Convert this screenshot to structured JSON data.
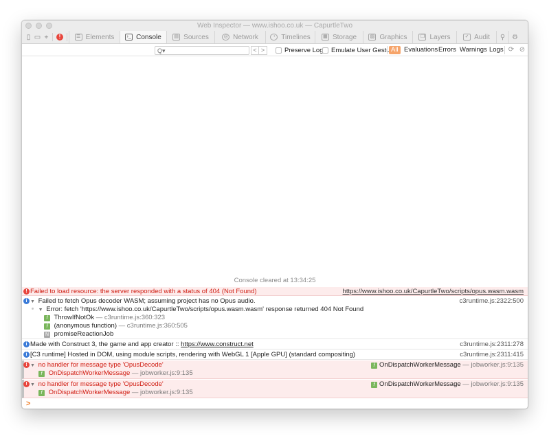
{
  "window": {
    "title": "Web Inspector — www.ishoo.co.uk — CapurtleTwo"
  },
  "tabs": [
    {
      "label": "Elements",
      "active": false
    },
    {
      "label": "Console",
      "active": true
    },
    {
      "label": "Sources",
      "active": false
    },
    {
      "label": "Network",
      "active": false
    },
    {
      "label": "Timelines",
      "active": false
    },
    {
      "label": "Storage",
      "active": false
    },
    {
      "label": "Graphics",
      "active": false
    },
    {
      "label": "Layers",
      "active": false
    },
    {
      "label": "Audit",
      "active": false
    }
  ],
  "toolbar": {
    "error_badge": "!"
  },
  "filter": {
    "preserve_log": "Preserve Log",
    "emulate_gesture": "Emulate User Gesture",
    "levels": [
      "All",
      "Evaluations",
      "Errors",
      "Warnings",
      "Logs"
    ],
    "prev": "<",
    "next": ">"
  },
  "console": {
    "cleared": "Console cleared at 13:34:25",
    "prompt": ">",
    "messages": [
      {
        "text": "Failed to load resource: the server responded with a status of 404 (Not Found)",
        "source": "https://www.ishoo.co.uk/CapurtleTwo/scripts/opus.wasm.wasm"
      },
      {
        "text": "Failed to fetch Opus decoder WASM; assuming project has no Opus audio.",
        "source": "c3runtime.js:2322:500",
        "error_line": "Error: fetch 'https://www.ishoo.co.uk/CapurtleTwo/scripts/opus.wasm.wasm' response returned 404 Not Found",
        "stack": [
          {
            "fn": "ThrowIfNotOk",
            "loc": "— c3runtime.js:360:323"
          },
          {
            "fn": "(anonymous function)",
            "loc": "— c3runtime.js:360:505"
          },
          {
            "fn": "promiseReactionJob",
            "loc": ""
          }
        ]
      },
      {
        "text_prefix": "Made with Construct 3, the game and app creator :: ",
        "link": "https://www.construct.net",
        "source": "c3runtime.js:2311:278"
      },
      {
        "text": "[C3 runtime] Hosted in DOM, using module scripts, rendering with WebGL 1 [Apple GPU] (standard compositing)",
        "source": "c3runtime.js:2311:415"
      },
      {
        "text": "no handler for message type 'OpusDecode'",
        "source_fn": "OnDispatchWorkerMessage",
        "source_loc": "— jobworker.js:9:135",
        "stack_fn": "OnDispatchWorkerMessage",
        "stack_loc": "— jobworker.js:9:135"
      },
      {
        "text": "no handler for message type 'OpusDecode'",
        "source_fn": "OnDispatchWorkerMessage",
        "source_loc": "— jobworker.js:9:135",
        "stack_fn": "OnDispatchWorkerMessage",
        "stack_loc": "— jobworker.js:9:135"
      }
    ]
  }
}
